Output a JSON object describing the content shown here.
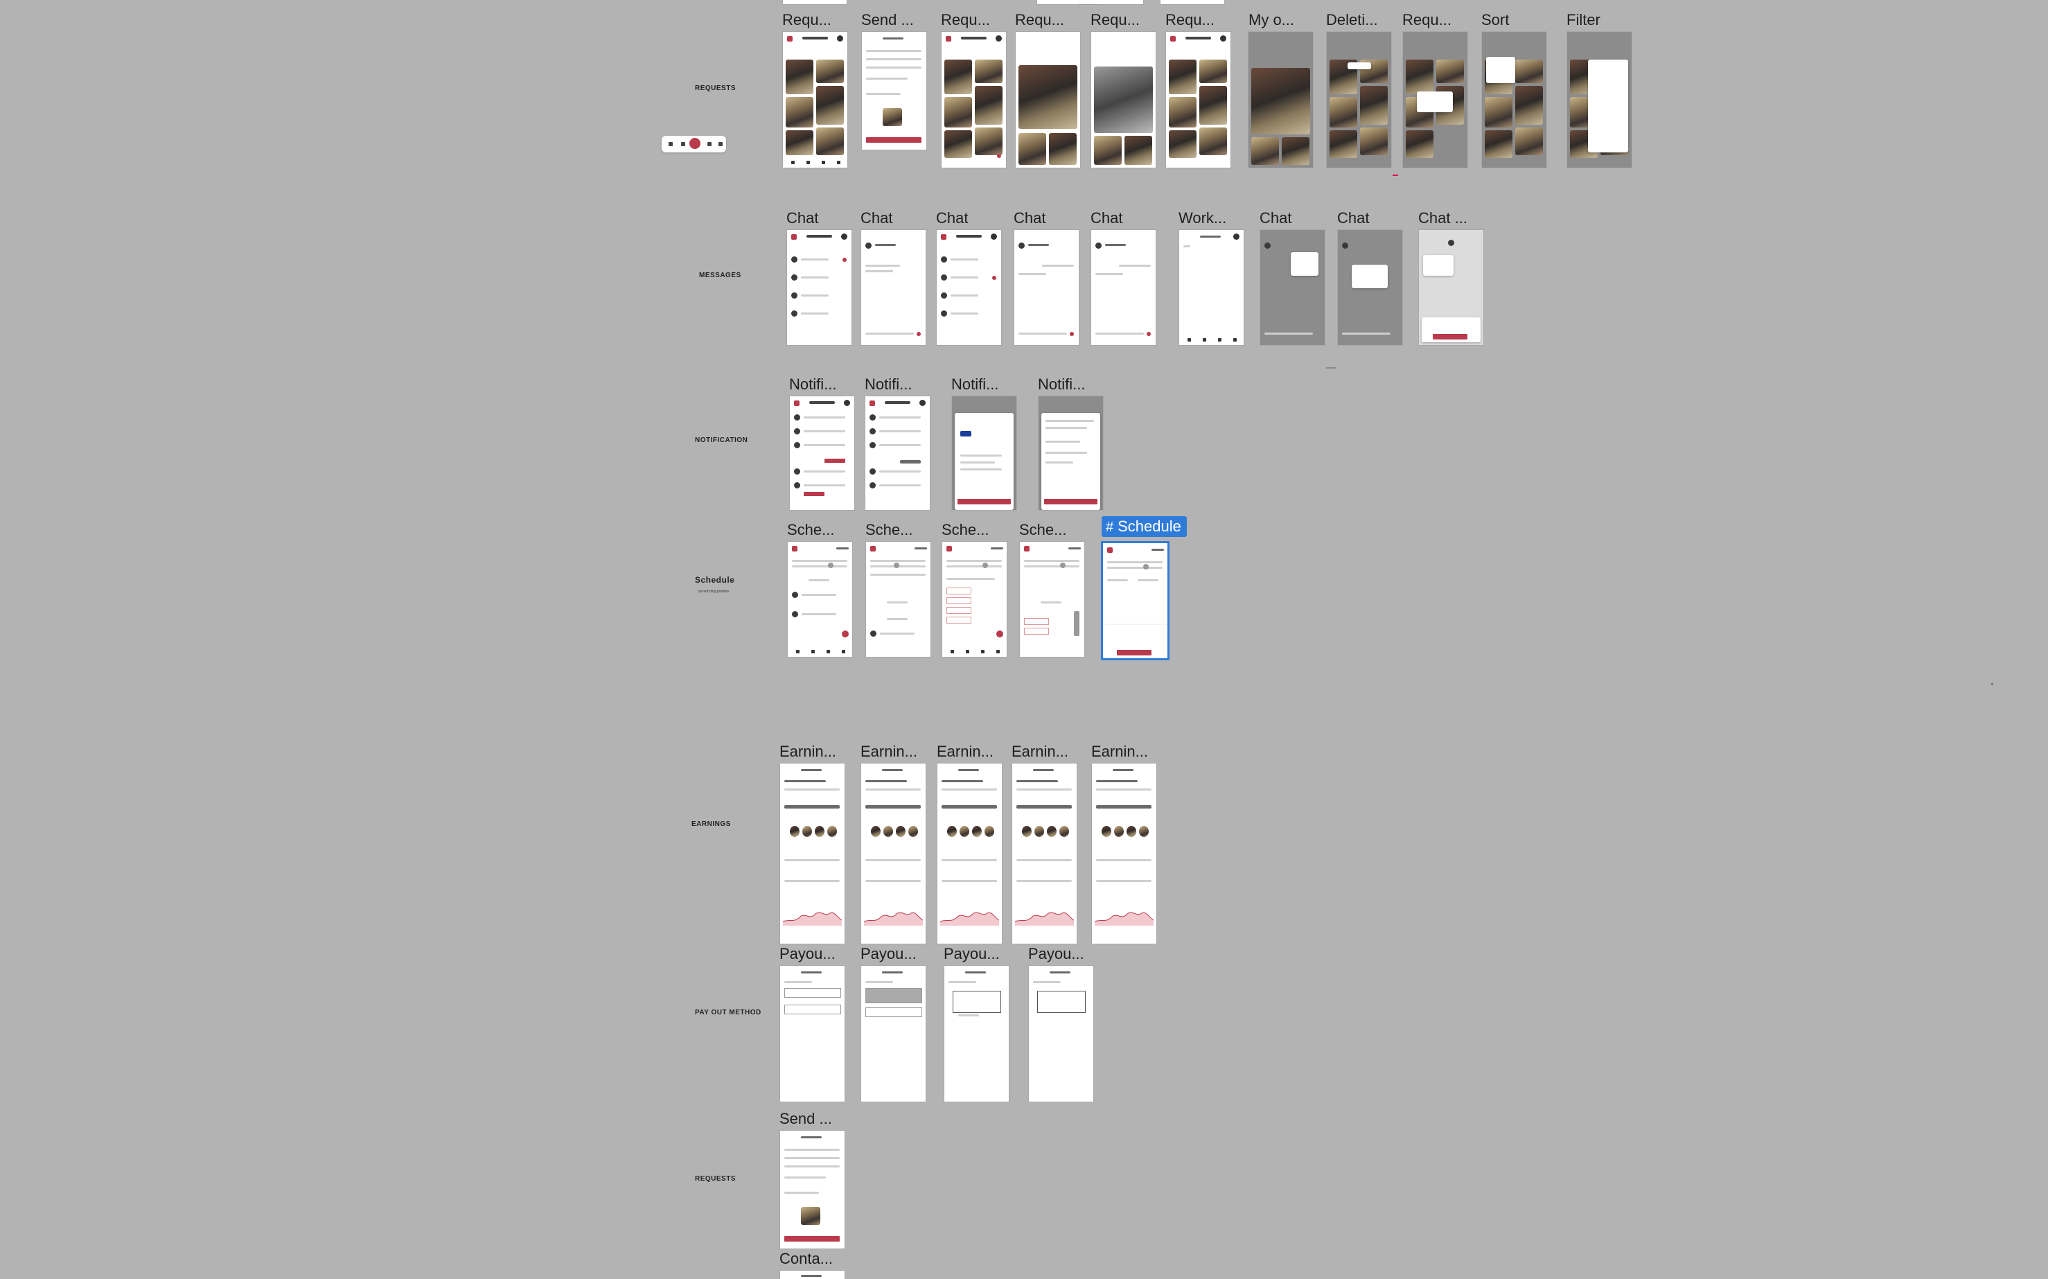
{
  "sections": {
    "requests": "REQUESTS",
    "messages": "MESSAGES",
    "notification": "NOTIFICATION",
    "schedule": "Schedule",
    "schedule_sub": "current blog position",
    "earnings": "EARNINGS",
    "payout": "PAY OUT METHOD",
    "requests2": "REQUESTS"
  },
  "titles": {
    "req_row": [
      "Requ...",
      "Send ...",
      "Requ...",
      "Requ...",
      "Requ...",
      "Requ...",
      "My o...",
      "Deleti...",
      "Requ...",
      "Sort",
      "Filter"
    ],
    "chat_row": [
      "Chat",
      "Chat",
      "Chat",
      "Chat",
      "Chat",
      "Work...",
      "Chat",
      "Chat",
      "Chat ..."
    ],
    "notif_row": [
      "Notifi...",
      "Notifi...",
      "Notifi...",
      "Notifi..."
    ],
    "sched_row": [
      "Sche...",
      "Sche...",
      "Sche...",
      "Sche..."
    ],
    "earn_row": [
      "Earnin...",
      "Earnin...",
      "Earnin...",
      "Earnin...",
      "Earnin..."
    ],
    "payout_row": [
      "Payou...",
      "Payou...",
      "Payou...",
      "Payou..."
    ],
    "send_single": "Send ...",
    "contact_single": "Conta..."
  },
  "selection": {
    "label": "Schedule",
    "icon": "frame-hash-icon"
  },
  "colors": {
    "canvas": "#b3b3b3",
    "accent": "#b83a4b",
    "selection": "#2f7bd9"
  }
}
